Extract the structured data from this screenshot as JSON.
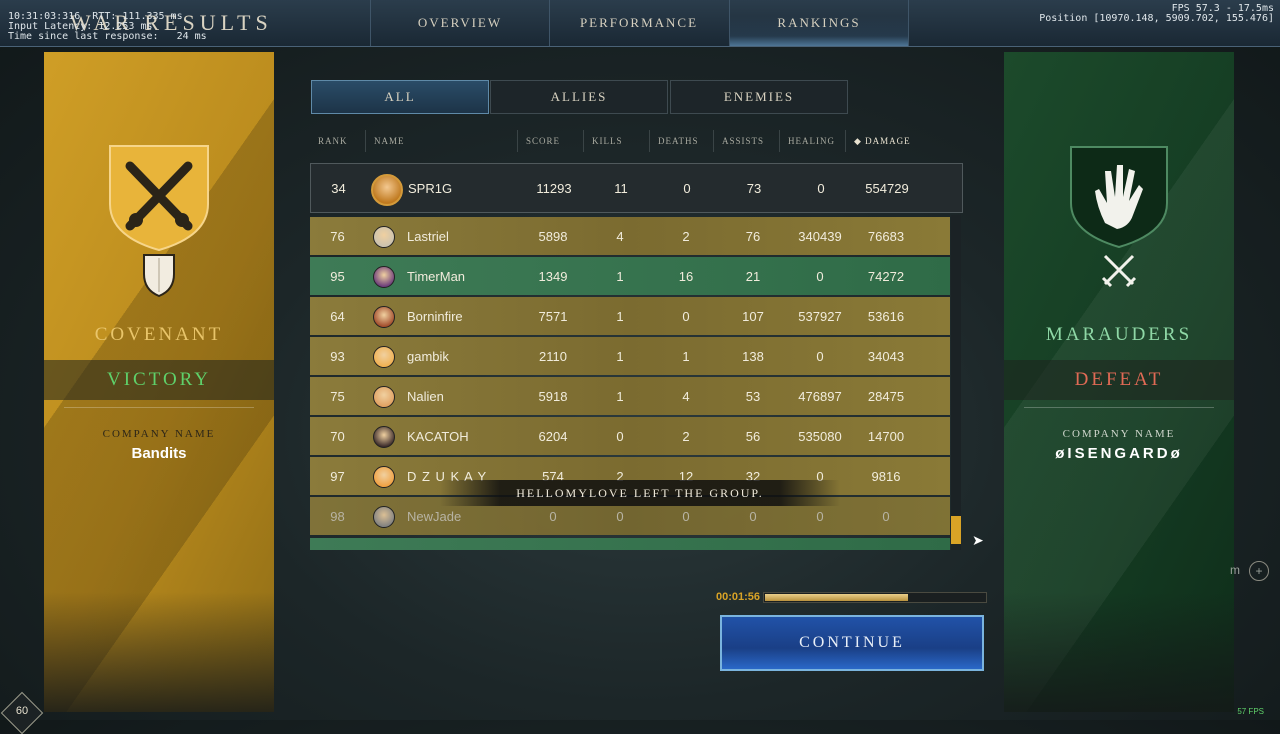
{
  "debug": {
    "line1": "10:31:03:316  RTT: 111.335 ms",
    "line2": "Input Latency: 12.253 ms",
    "line3": "Time since last response:   24 ms",
    "fps": "FPS 57.3 - 17.5ms",
    "position": "Position [10970.148, 5909.702, 155.476]"
  },
  "header": {
    "title": "WAR RESULTS",
    "nav": [
      "OVERVIEW",
      "PERFORMANCE",
      "RANKINGS"
    ],
    "active_nav": "RANKINGS"
  },
  "filter_tabs": [
    "ALL",
    "ALLIES",
    "ENEMIES"
  ],
  "columns": [
    "RANK",
    "NAME",
    "SCORE",
    "KILLS",
    "DEATHS",
    "ASSISTS",
    "HEALING",
    "◆ DAMAGE"
  ],
  "self_row": {
    "rank": "34",
    "name": "SPR1G",
    "score": "11293",
    "kills": "11",
    "deaths": "0",
    "assists": "73",
    "healing": "0",
    "damage": "554729"
  },
  "rows": [
    {
      "rank": "76",
      "name": "Lastriel",
      "score": "5898",
      "kills": "4",
      "deaths": "2",
      "assists": "76",
      "healing": "340439",
      "damage": "76683",
      "side": "ally"
    },
    {
      "rank": "95",
      "name": "TimerMan",
      "score": "1349",
      "kills": "1",
      "deaths": "16",
      "assists": "21",
      "healing": "0",
      "damage": "74272",
      "side": "enemy"
    },
    {
      "rank": "64",
      "name": "Borninfire",
      "score": "7571",
      "kills": "1",
      "deaths": "0",
      "assists": "107",
      "healing": "537927",
      "damage": "53616",
      "side": "ally"
    },
    {
      "rank": "93",
      "name": "gambik",
      "score": "2110",
      "kills": "1",
      "deaths": "1",
      "assists": "138",
      "healing": "0",
      "damage": "34043",
      "side": "ally"
    },
    {
      "rank": "75",
      "name": "Nalien",
      "score": "5918",
      "kills": "1",
      "deaths": "4",
      "assists": "53",
      "healing": "476897",
      "damage": "28475",
      "side": "ally"
    },
    {
      "rank": "70",
      "name": "KACATOH",
      "score": "6204",
      "kills": "0",
      "deaths": "2",
      "assists": "56",
      "healing": "535080",
      "damage": "14700",
      "side": "ally"
    },
    {
      "rank": "97",
      "name": "D Z U K A Y",
      "score": "574",
      "kills": "2",
      "deaths": "12",
      "assists": "32",
      "healing": "0",
      "damage": "9816",
      "side": "ally"
    },
    {
      "rank": "98",
      "name": "NewJade",
      "score": "0",
      "kills": "0",
      "deaths": "0",
      "assists": "0",
      "healing": "0",
      "damage": "0",
      "side": "ally"
    }
  ],
  "toast": "HELLOMYLOVE LEFT THE GROUP.",
  "left_faction": {
    "name": "COVENANT",
    "outcome": "VICTORY",
    "company_label": "COMPANY NAME",
    "company": "Bandits",
    "name_color": "#e9c56a",
    "outcome_color": "#5fd06a"
  },
  "right_faction": {
    "name": "MARAUDERS",
    "outcome": "DEFEAT",
    "company_label": "COMPANY NAME",
    "company": "øISENGARDø",
    "name_color": "#8fd8a6",
    "outcome_color": "#e06a55"
  },
  "timer": {
    "text": "00:01:56",
    "progress": 0.65
  },
  "continue_label": "CONTINUE",
  "player_level": "60",
  "fps_bottom": "57 FPS",
  "side_hint": "m"
}
